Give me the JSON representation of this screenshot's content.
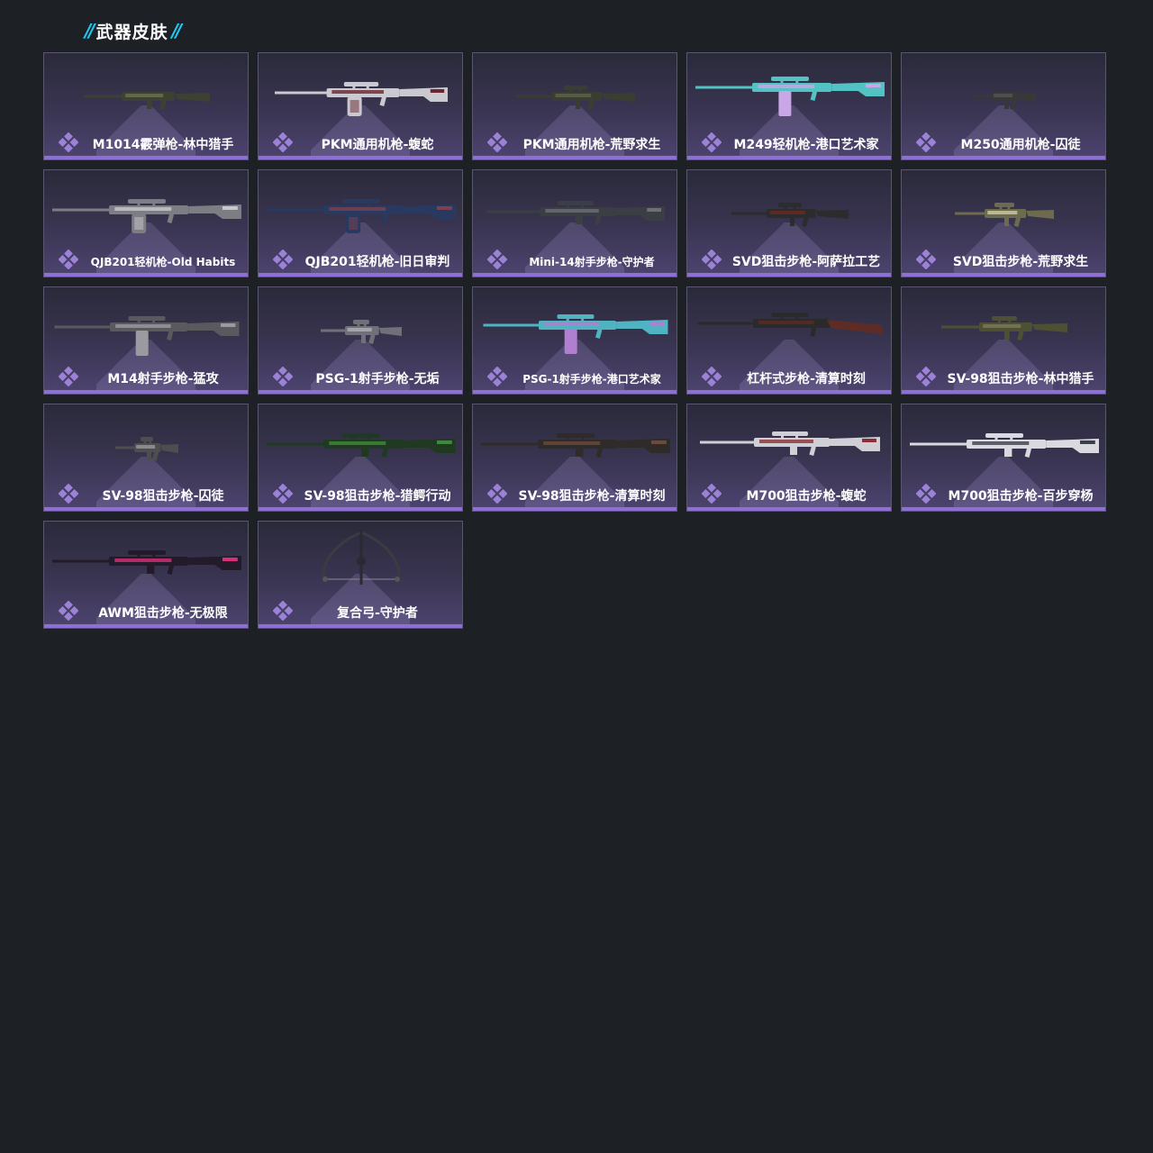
{
  "section": {
    "title": "武器皮肤",
    "slash_left": "//",
    "slash_right": "//"
  },
  "colors": {
    "background": "#1d2025",
    "accent_cyan": "#20c8f0",
    "card_bottom_bar": "#8e6fd8",
    "rarity_icon": "#9b82d6"
  },
  "skins": [
    {
      "name": "M1014霰弹枪-林中猎手",
      "icon": "shotgun-icon"
    },
    {
      "name": "PKM通用机枪-蝮蛇",
      "icon": "machine-gun-icon"
    },
    {
      "name": "PKM通用机枪-荒野求生",
      "icon": "machine-gun-icon"
    },
    {
      "name": "M249轻机枪-港口艺术家",
      "icon": "light-machine-gun-icon"
    },
    {
      "name": "M250通用机枪-囚徒",
      "icon": "machine-gun-icon"
    },
    {
      "name": "QJB201轻机枪-Old Habits",
      "icon": "light-machine-gun-icon"
    },
    {
      "name": "QJB201轻机枪-旧日审判",
      "icon": "light-machine-gun-icon"
    },
    {
      "name": "Mini-14射手步枪-守护者",
      "icon": "rifle-icon"
    },
    {
      "name": "SVD狙击步枪-阿萨拉工艺",
      "icon": "sniper-rifle-icon"
    },
    {
      "name": "SVD狙击步枪-荒野求生",
      "icon": "sniper-rifle-icon"
    },
    {
      "name": "M14射手步枪-猛攻",
      "icon": "rifle-icon"
    },
    {
      "name": "PSG-1射手步枪-无垢",
      "icon": "rifle-icon"
    },
    {
      "name": "PSG-1射手步枪-港口艺术家",
      "icon": "rifle-icon"
    },
    {
      "name": "杠杆式步枪-清算时刻",
      "icon": "lever-rifle-icon"
    },
    {
      "name": "SV-98狙击步枪-林中猎手",
      "icon": "sniper-rifle-icon"
    },
    {
      "name": "SV-98狙击步枪-囚徒",
      "icon": "sniper-rifle-icon"
    },
    {
      "name": "SV-98狙击步枪-猎鳄行动",
      "icon": "sniper-rifle-icon"
    },
    {
      "name": "SV-98狙击步枪-清算时刻",
      "icon": "sniper-rifle-icon"
    },
    {
      "name": "M700狙击步枪-蝮蛇",
      "icon": "sniper-rifle-icon"
    },
    {
      "name": "M700狙击步枪-百步穿杨",
      "icon": "sniper-rifle-icon"
    },
    {
      "name": "AWM狙击步枪-无极限",
      "icon": "sniper-rifle-icon"
    },
    {
      "name": "复合弓-守护者",
      "icon": "compound-bow-icon"
    }
  ]
}
